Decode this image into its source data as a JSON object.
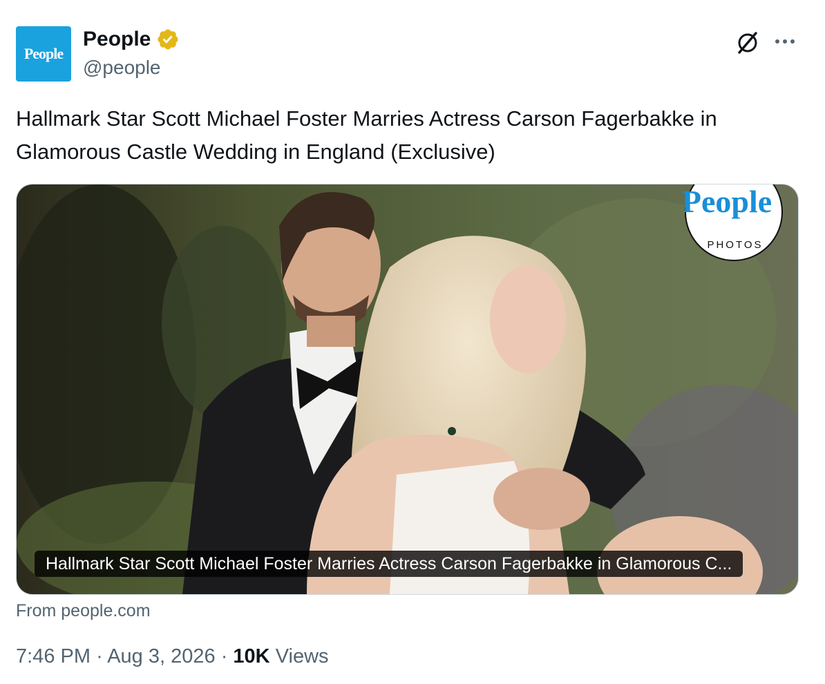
{
  "author": {
    "avatar_text": "People",
    "display_name": "People",
    "handle": "@people",
    "verified": true,
    "avatar_color": "#1aa2df",
    "verified_color": "#e2b719"
  },
  "actions": {
    "grok_icon": "grok-icon",
    "more_icon": "more-dots-icon"
  },
  "tweet": {
    "text": "Hallmark Star Scott Michael Foster Marries Actress Carson Fagerbakke in Glamorous Castle Wedding in England (Exclusive)"
  },
  "card": {
    "caption": "Hallmark Star Scott Michael Foster Marries Actress Carson Fagerbakke in Glamorous C...",
    "badge_logo": "People",
    "badge_sub": "PHOTOS",
    "source": "From people.com"
  },
  "meta": {
    "time": "7:46 PM",
    "date": "Aug 3, 2026",
    "views_count": "10K",
    "views_label": "Views",
    "separator": "·"
  }
}
